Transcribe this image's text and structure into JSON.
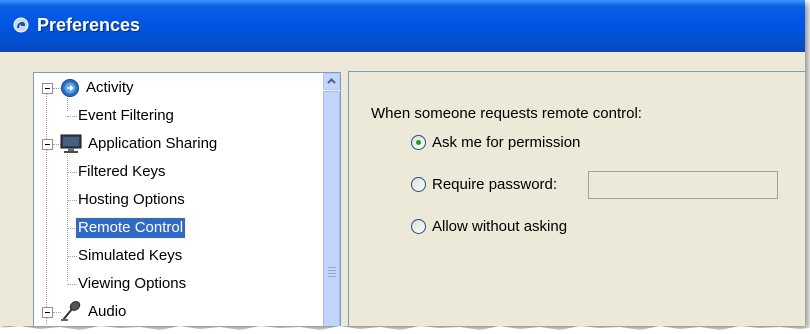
{
  "window": {
    "title": "Preferences",
    "icon": "app-icon"
  },
  "tree": {
    "items": [
      {
        "label": "Activity",
        "level": 0,
        "expanded": true,
        "icon": "activity-icon"
      },
      {
        "label": "Event Filtering",
        "level": 1
      },
      {
        "label": "Application Sharing",
        "level": 0,
        "expanded": true,
        "icon": "monitor-icon"
      },
      {
        "label": "Filtered Keys",
        "level": 1
      },
      {
        "label": "Hosting Options",
        "level": 1
      },
      {
        "label": "Remote Control",
        "level": 1,
        "selected": true
      },
      {
        "label": "Simulated Keys",
        "level": 1
      },
      {
        "label": "Viewing Options",
        "level": 1
      },
      {
        "label": "Audio",
        "level": 0,
        "expanded": true,
        "icon": "microphone-icon"
      }
    ]
  },
  "panel": {
    "prompt": "When someone requests remote control:",
    "options": [
      {
        "label": "Ask me for permission",
        "checked": true
      },
      {
        "label": "Require password:",
        "checked": false
      },
      {
        "label": "Allow without asking",
        "checked": false
      }
    ],
    "password_value": ""
  }
}
